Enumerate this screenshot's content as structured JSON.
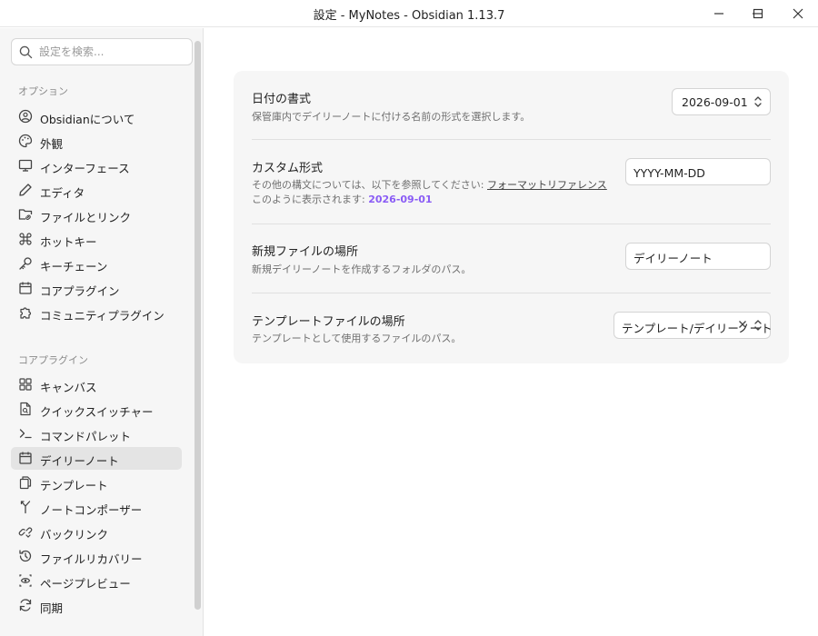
{
  "window": {
    "title": "設定 - MyNotes - Obsidian 1.13.7"
  },
  "sidebar": {
    "search_placeholder": "設定を検索...",
    "options_title": "オプション",
    "options_items": [
      {
        "label": "Obsidianについて",
        "icon": "info-circle-icon"
      },
      {
        "label": "外観",
        "icon": "palette-icon"
      },
      {
        "label": "インターフェース",
        "icon": "monitor-icon"
      },
      {
        "label": "エディタ",
        "icon": "pen-icon"
      },
      {
        "label": "ファイルとリンク",
        "icon": "folder-link-icon"
      },
      {
        "label": "ホットキー",
        "icon": "command-icon"
      },
      {
        "label": "キーチェーン",
        "icon": "key-icon"
      },
      {
        "label": "コアプラグイン",
        "icon": "calendar-icon"
      },
      {
        "label": "コミュニティプラグイン",
        "icon": "puzzle-icon"
      }
    ],
    "plugins_title": "コアプラグイン",
    "plugin_items": [
      {
        "label": "キャンバス",
        "icon": "layout-grid-icon"
      },
      {
        "label": "クイックスイッチャー",
        "icon": "file-search-icon"
      },
      {
        "label": "コマンドパレット",
        "icon": "terminal-icon"
      },
      {
        "label": "デイリーノート",
        "icon": "calendar-icon",
        "active": true
      },
      {
        "label": "テンプレート",
        "icon": "files-icon"
      },
      {
        "label": "ノートコンポーザー",
        "icon": "merge-icon"
      },
      {
        "label": "バックリンク",
        "icon": "backlink-icon"
      },
      {
        "label": "ファイルリカバリー",
        "icon": "history-icon"
      },
      {
        "label": "ページプレビュー",
        "icon": "eye-icon"
      },
      {
        "label": "同期",
        "icon": "sync-icon"
      }
    ]
  },
  "settings": {
    "date_format": {
      "title": "日付の書式",
      "description": "保管庫内でデイリーノートに付ける名前の形式を選択します。",
      "value": "2026-09-01"
    },
    "custom_format": {
      "title": "カスタム形式",
      "description_prefix": "その他の構文については、以下を参照してください: ",
      "link_text": "フォーマットリファレンス",
      "preview_prefix": "このように表示されます: ",
      "preview_value": "2026-09-01",
      "value": "YYYY-MM-DD"
    },
    "new_file_location": {
      "title": "新規ファイルの場所",
      "description": "新規デイリーノートを作成するフォルダのパス。",
      "value": "デイリーノート"
    },
    "template_location": {
      "title": "テンプレートファイルの場所",
      "description": "テンプレートとして使用するファイルのパス。",
      "value": "テンプレート/デイリーノート"
    }
  },
  "colors": {
    "accent": "#8a5cf5",
    "sidebar_bg": "#f6f6f6",
    "active_item_bg": "#e4e4e4"
  }
}
